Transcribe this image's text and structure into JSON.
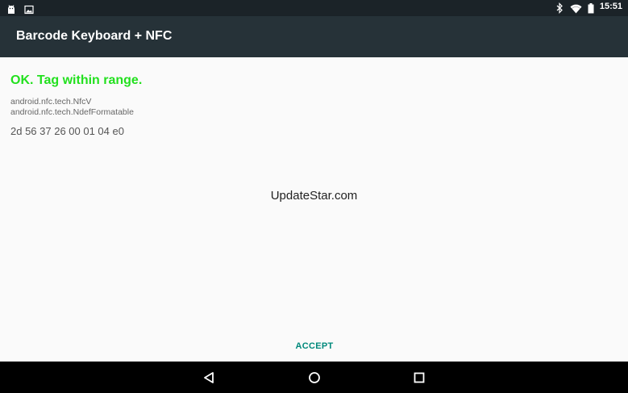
{
  "status_bar": {
    "time": "15:51",
    "left_icons": [
      "android-icon",
      "image-icon"
    ],
    "right_icons": [
      "bluetooth-icon",
      "wifi-icon",
      "battery-icon"
    ]
  },
  "app_bar": {
    "title": "Barcode Keyboard + NFC"
  },
  "content": {
    "status_message": "OK. Tag within range.",
    "tech_list": [
      "android.nfc.tech.NfcV",
      "android.nfc.tech.NdefFormatable"
    ],
    "tag_id": "2d 56 37 26 00 01 04 e0",
    "watermark": "UpdateStar.com"
  },
  "actions": {
    "accept_label": "ACCEPT"
  },
  "nav_bar": {
    "icons": [
      "back-icon",
      "home-icon",
      "recents-icon"
    ]
  },
  "colors": {
    "status_bar": "#1b2328",
    "app_bar": "#263238",
    "status_ok": "#22e01e",
    "accent": "#00897b",
    "background": "#fafafa"
  }
}
